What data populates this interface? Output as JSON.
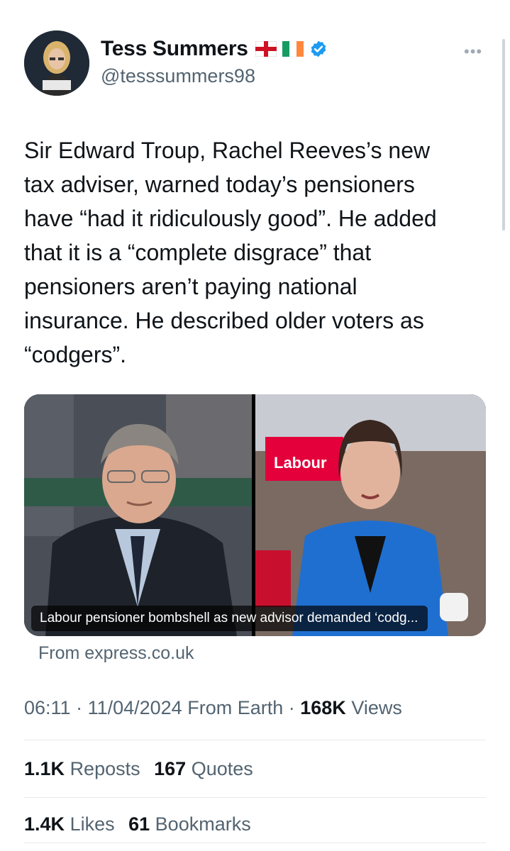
{
  "author": {
    "name": "Tess Summers",
    "handle": "@tesssummers98",
    "verified": true,
    "flags": [
      "england-flag-icon",
      "ireland-flag-icon"
    ]
  },
  "tweet": {
    "text": "Sir Edward Troup, Rachel Reeves’s new\ntax adviser, warned today’s pensioners\nhave “had it ridiculously good”. He added\nthat it is a “complete disgrace” that\npensioners aren’t paying national\ninsurance. He described older voters as\n“codgers”."
  },
  "card": {
    "caption": "Labour pensioner bombshell as new advisor demanded ‘codg...",
    "source": "From express.co.uk",
    "sign_text": "Labour"
  },
  "meta": {
    "time": "06:11",
    "date": "11/04/2024",
    "location": "From Earth",
    "views_count": "168K",
    "views_label": "Views"
  },
  "stats": {
    "reposts_count": "1.1K",
    "reposts_label": "Reposts",
    "quotes_count": "167",
    "quotes_label": "Quotes",
    "likes_count": "1.4K",
    "likes_label": "Likes",
    "bookmarks_count": "61",
    "bookmarks_label": "Bookmarks"
  },
  "colors": {
    "text": "#0f1419",
    "secondary": "#536471",
    "verified": "#1d9bf0",
    "labour_red": "#e4003b"
  }
}
